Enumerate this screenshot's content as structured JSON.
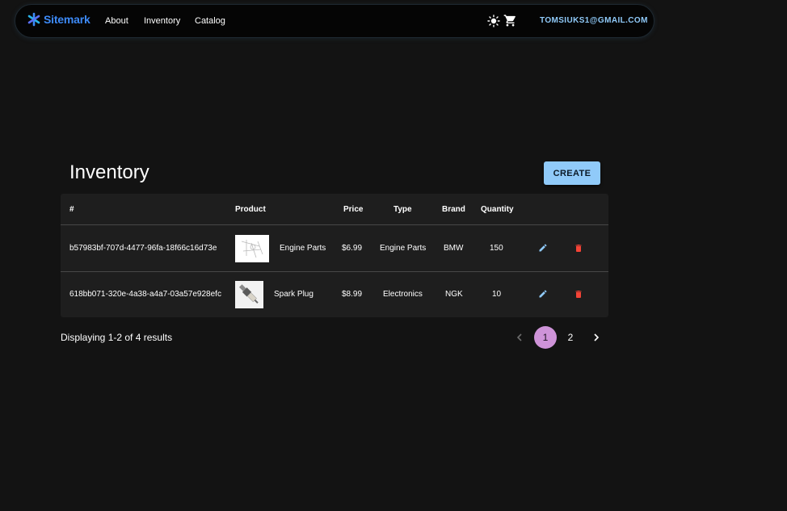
{
  "nav": {
    "brand": "Sitemark",
    "links": [
      "About",
      "Inventory",
      "Catalog"
    ],
    "user_email": "TOMSIUKS1@GMAIL.COM",
    "icons": [
      "sun-icon",
      "cart-icon"
    ]
  },
  "page": {
    "title": "Inventory",
    "create_label": "CREATE"
  },
  "table": {
    "headers": [
      "#",
      "Product",
      "Price",
      "Type",
      "Brand",
      "Quantity"
    ],
    "rows": [
      {
        "id": "b57983bf-707d-4477-96fa-18f66c16d73e",
        "product": "Engine Parts",
        "price": "$6.99",
        "type": "Engine Parts",
        "brand": "BMW",
        "quantity": "150"
      },
      {
        "id": "618bb071-320e-4a38-a4a7-03a57e928efc",
        "product": "Spark Plug",
        "price": "$8.99",
        "type": "Electronics",
        "brand": "NGK",
        "quantity": "10"
      }
    ]
  },
  "pagination": {
    "summary": "Displaying 1-2 of 4 results",
    "pages": [
      "1",
      "2"
    ],
    "current": "1"
  },
  "colors": {
    "accent": "#90caf9",
    "brand": "#3d8af7",
    "active_page": "#ce93d8",
    "delete": "#f44336"
  }
}
